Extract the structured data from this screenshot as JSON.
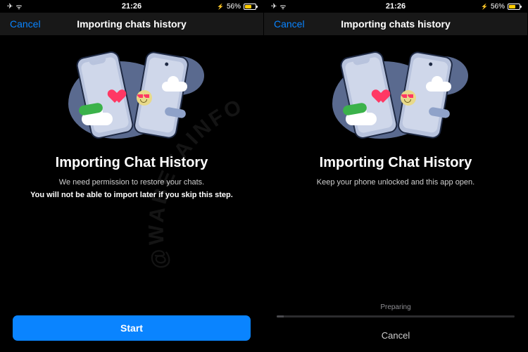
{
  "status": {
    "time": "21:26",
    "battery_pct": "56%",
    "airplane_glyph": "✈",
    "wifi_glyph": "ᯤ",
    "bolt_glyph": "⚡"
  },
  "nav": {
    "cancel": "Cancel",
    "title": "Importing chats history"
  },
  "left": {
    "heading": "Importing Chat History",
    "line1": "We need permission to restore your chats.",
    "line2": "You will not be able to import later if you skip this step.",
    "cta": "Start"
  },
  "right": {
    "heading": "Importing Chat History",
    "line1": "Keep your phone unlocked and this app open.",
    "preparing": "Preparing",
    "cancel": "Cancel"
  },
  "watermark": "@WABETAINFO"
}
